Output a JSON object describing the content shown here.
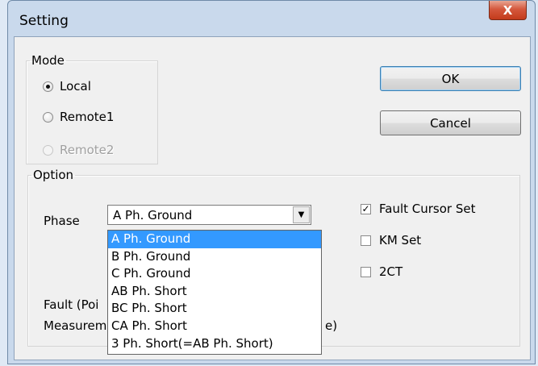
{
  "window": {
    "title": "Setting",
    "close_glyph": "X"
  },
  "mode": {
    "legend": "Mode",
    "options": [
      {
        "label": "Local",
        "checked": true,
        "enabled": true
      },
      {
        "label": "Remote1",
        "checked": false,
        "enabled": true
      },
      {
        "label": "Remote2",
        "checked": false,
        "enabled": false
      }
    ]
  },
  "buttons": {
    "ok": "OK",
    "cancel": "Cancel"
  },
  "option": {
    "legend": "Option",
    "phase_label": "Phase",
    "phase_selected": "A Ph. Ground",
    "fault_label": "Fault (Poi",
    "measurement_label": "Measurem",
    "measurement_suffix": "e)",
    "checkboxes": [
      {
        "label": "Fault Cursor Set",
        "checked": true
      },
      {
        "label": "KM Set",
        "checked": false
      },
      {
        "label": "2CT",
        "checked": false
      }
    ]
  },
  "dropdown": {
    "items": [
      "A Ph. Ground",
      "B Ph. Ground",
      "C Ph. Ground",
      "AB Ph. Short",
      "BC Ph. Short",
      "CA Ph. Short",
      "3 Ph. Short(=AB Ph. Short)"
    ],
    "selected_index": 0
  },
  "colors": {
    "selection": "#3399ff",
    "close_button": "#c33b1c"
  }
}
